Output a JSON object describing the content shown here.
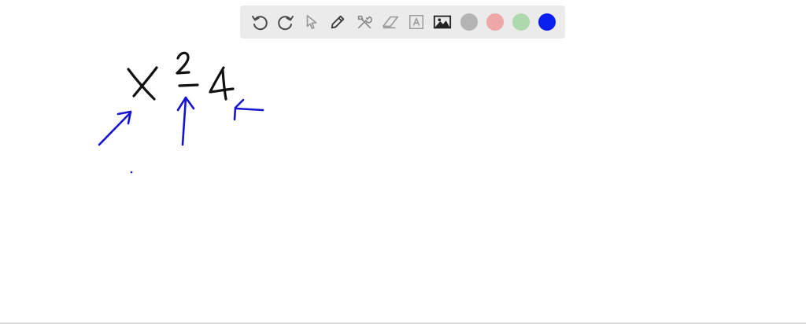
{
  "toolbar": {
    "tools": [
      {
        "name": "undo-icon"
      },
      {
        "name": "redo-icon"
      },
      {
        "name": "pointer-icon"
      },
      {
        "name": "pen-icon"
      },
      {
        "name": "tools-icon"
      },
      {
        "name": "eraser-icon"
      },
      {
        "name": "text-box-icon"
      },
      {
        "name": "image-icon"
      }
    ],
    "colors": [
      {
        "name": "color-gray",
        "hex": "#b4b4b4"
      },
      {
        "name": "color-pink",
        "hex": "#eda7a7"
      },
      {
        "name": "color-green",
        "hex": "#aed8ae"
      },
      {
        "name": "color-blue",
        "hex": "#0a1ff0"
      }
    ]
  },
  "drawing": {
    "ink_colors": {
      "black": "#111111",
      "blue": "#1414d2"
    }
  }
}
